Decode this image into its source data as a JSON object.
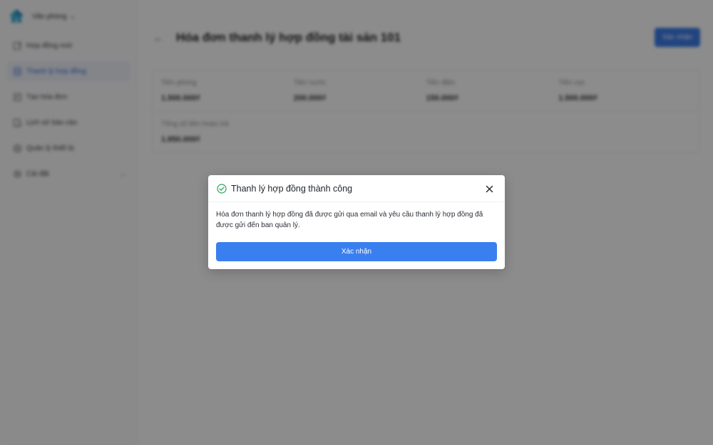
{
  "sidebar": {
    "brand_name": "Văn phòng",
    "items": [
      {
        "label": "Hợp đồng mới",
        "icon": "edit-document-icon"
      },
      {
        "label": "Thanh lý hợp đồng",
        "icon": "document-icon"
      },
      {
        "label": "Tạo hóa đơn",
        "icon": "receipt-icon"
      },
      {
        "label": "Lịch sử báo cáo",
        "icon": "history-icon"
      },
      {
        "label": "Quản lý thiết bị",
        "icon": "device-icon"
      },
      {
        "label": "Cài đặt",
        "icon": "gear-icon"
      }
    ]
  },
  "header": {
    "title": "Hóa đơn thanh lý hợp đồng tài sản 101",
    "primary_button": "Xác nhận"
  },
  "summary": {
    "fields": [
      {
        "label": "Tiền phòng",
        "value": "1.500.000₫"
      },
      {
        "label": "Tiền nước",
        "value": "200.000₫"
      },
      {
        "label": "Tiền điện",
        "value": "150.000₫"
      },
      {
        "label": "Tiền cọc",
        "value": "1.500.000₫"
      }
    ],
    "total_label": "Tổng số tiền hoàn trả",
    "total_value": "1.850.000₫"
  },
  "modal": {
    "title": "Thanh lý hợp đồng thành công",
    "body": "Hóa đơn thanh lý hợp đồng đã được gửi qua email và yêu cầu thanh lý hợp đồng đã được gửi đến ban quản lý.",
    "confirm_label": "Xác nhận"
  },
  "colors": {
    "accent": "#3a7ff0",
    "success": "#27a65a"
  }
}
